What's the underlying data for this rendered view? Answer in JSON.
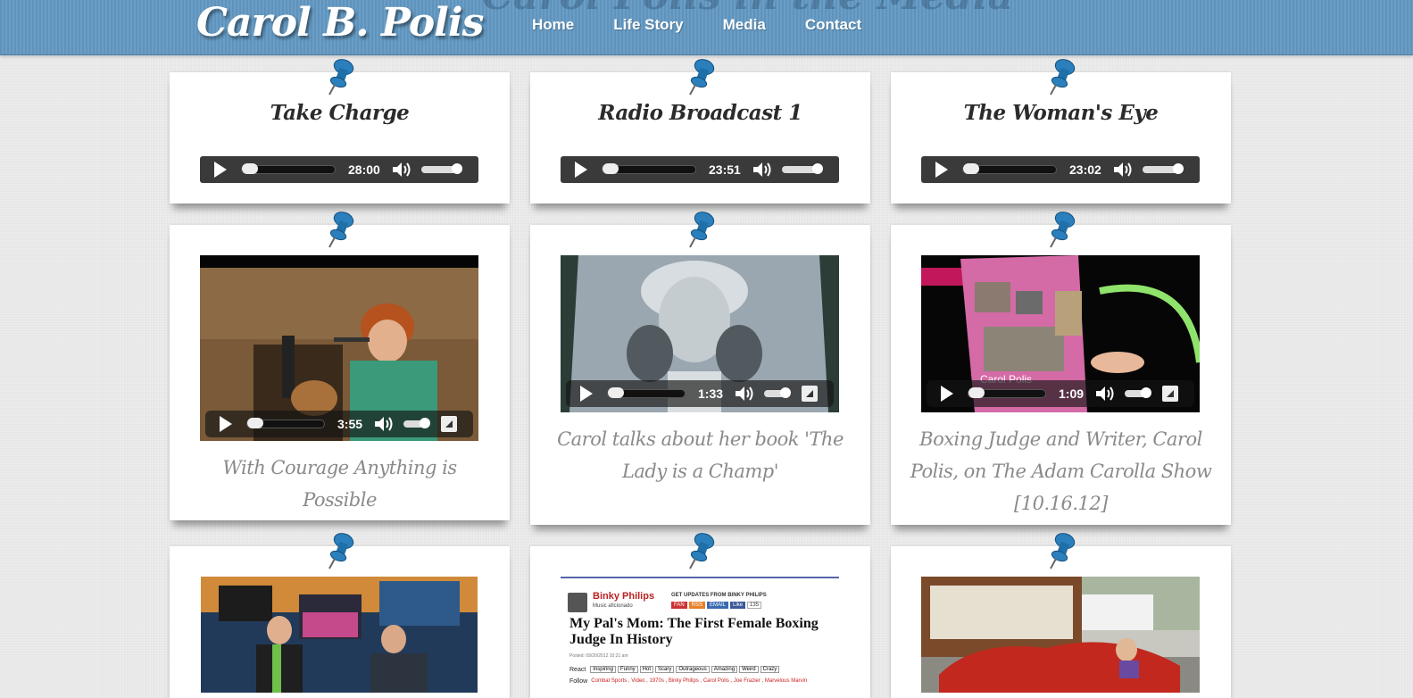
{
  "header": {
    "logo": "Carol B. Polis",
    "ghost_title": "Carol Polis in the Media",
    "nav": [
      "Home",
      "Life Story",
      "Media",
      "Contact"
    ]
  },
  "audio_cards": [
    {
      "title": "Take Charge",
      "time": "28:00"
    },
    {
      "title": "Radio Broadcast 1",
      "time": "23:51"
    },
    {
      "title": "The Woman's Eye",
      "time": "23:02"
    }
  ],
  "video_cards": [
    {
      "time": "3:55",
      "caption": "With Courage Anything is Possible"
    },
    {
      "time": "1:33",
      "caption": "Carol talks about her book 'The Lady is a Champ'"
    },
    {
      "time": "1:09",
      "caption": "Boxing Judge and Writer, Carol Polis, on The Adam Carolla Show [10.16.12]",
      "overlay_text": "Carol Polis"
    }
  ],
  "article": {
    "author": "Binky Philips",
    "author_sub": "Music aficionado",
    "updates": "GET UPDATES FROM BINKY PHILIPS",
    "fan": "FAN",
    "rss": "RSS",
    "email": "EMAIL",
    "like": "Like",
    "like_count": "135",
    "headline": "My Pal's Mom: The First Female Boxing Judge In History",
    "posted": "Posted: 09/20/2012 10:21 am",
    "react_label": "React",
    "reacts": [
      "Inspiring",
      "Funny",
      "Hot",
      "Scary",
      "Outrageous",
      "Amazing",
      "Weird",
      "Crazy"
    ],
    "follow_label": "Follow",
    "follow_text": "Combat Sports , Video , 1970s , Binky Philips , Carol Polis , Joe Frazier , Marvelous Marvin"
  },
  "colors": {
    "header_blue": "#6a9ec6",
    "pin_blue": "#1f6fa8",
    "player_dark": "#3a3a3a",
    "caption_gray": "#8a8a8a"
  }
}
